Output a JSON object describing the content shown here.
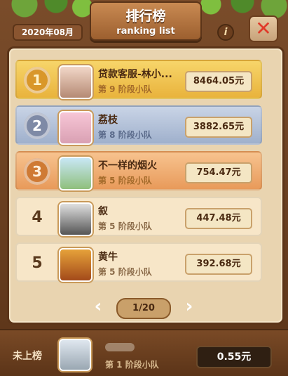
{
  "header": {
    "title_cn": "排行榜",
    "title_en": "ranking list",
    "date": "2020年08月",
    "info_icon": "info-icon",
    "close_icon": "close-icon"
  },
  "rows": [
    {
      "rank": "1",
      "name": "贷款客服-林小...",
      "stage": "第 9 阶段小队",
      "amount": "8464.05元",
      "medal": "gold"
    },
    {
      "rank": "2",
      "name": "荔枝",
      "stage": "第 8 阶段小队",
      "amount": "3882.65元",
      "medal": "silver"
    },
    {
      "rank": "3",
      "name": "不一样的烟火",
      "stage": "第 5 阶段小队",
      "amount": "754.47元",
      "medal": "bronze"
    },
    {
      "rank": "4",
      "name": "叙",
      "stage": "第 5 阶段小队",
      "amount": "447.48元",
      "medal": ""
    },
    {
      "rank": "5",
      "name": "黄牛",
      "stage": "第 5 阶段小队",
      "amount": "392.68元",
      "medal": ""
    }
  ],
  "pager": {
    "label": "1/20",
    "prev_icon": "chevron-left-icon",
    "next_icon": "chevron-right-icon"
  },
  "self": {
    "label": "未上榜",
    "stage": "第 1 阶段小队",
    "amount": "0.55元"
  }
}
